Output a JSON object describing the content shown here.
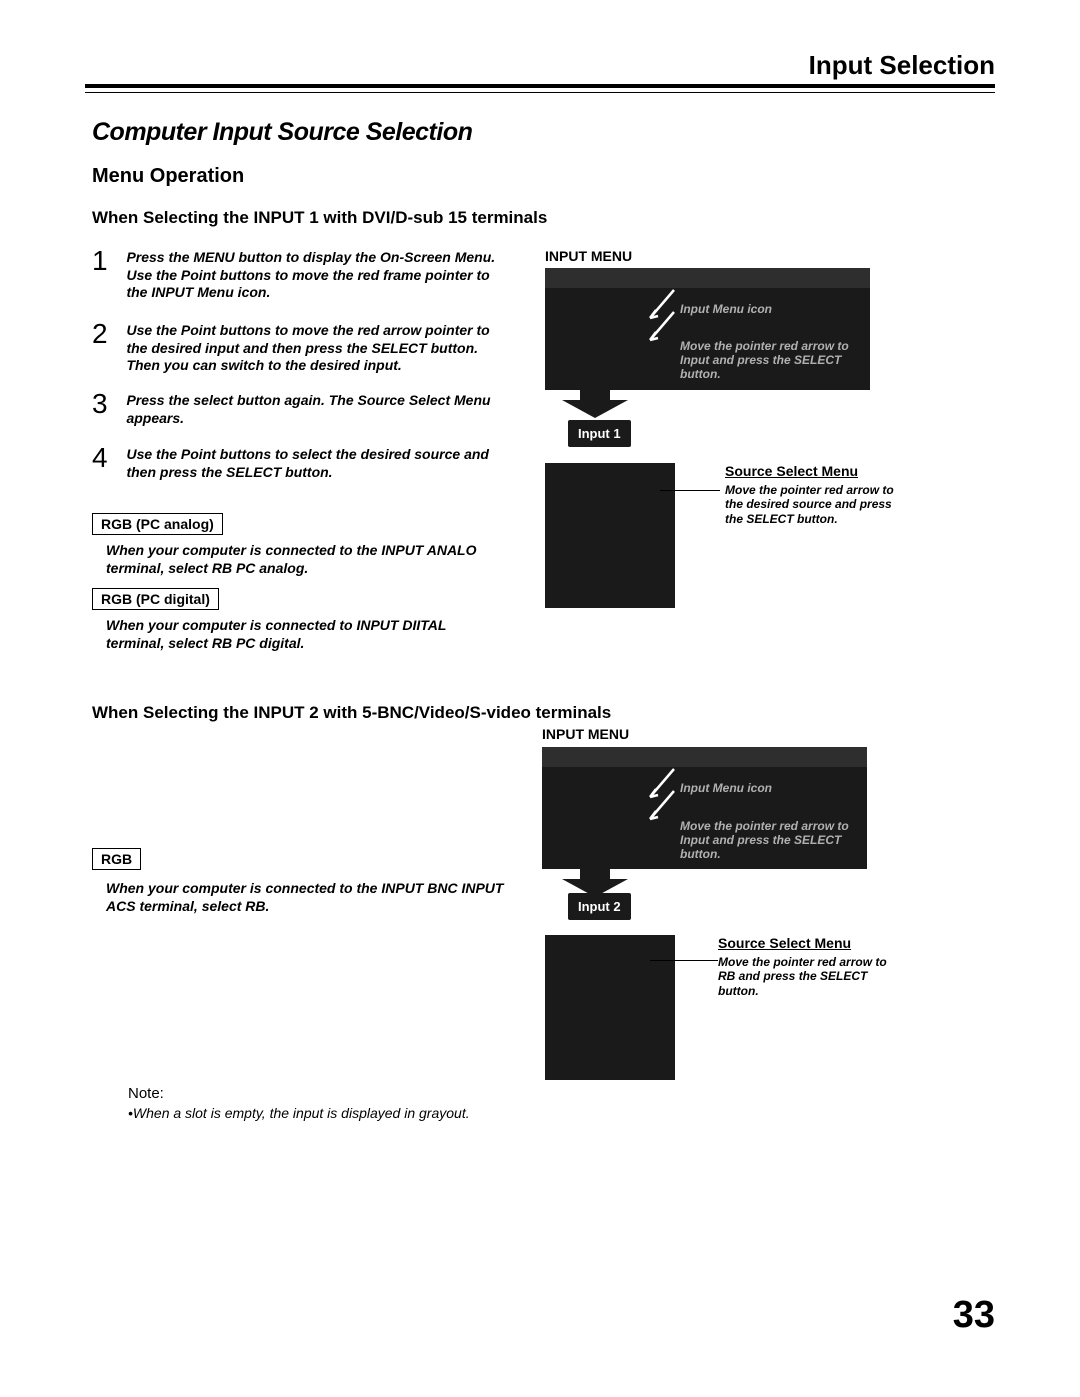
{
  "header": {
    "title": "Input Selection"
  },
  "section": {
    "title": "Computer Input Source Selection"
  },
  "menu_op": {
    "title": "Menu Operation"
  },
  "sub1": {
    "title": "When Selecting the INPUT 1 with DVI/D-sub 15 terminals"
  },
  "steps": {
    "s1": "Press the MENU button to display the On-Screen Menu. Use the Point       buttons to move the red frame pointer to the INPUT Menu icon.",
    "s2": "Use the Point       buttons to move the red arrow pointer to the desired input and then press the SELECT button. Then you can switch to the desired input.",
    "s3": "Press the select button again. The Source Select Menu appears.",
    "s4": "Use the Point       buttons to select the desired source and then press the SELECT button."
  },
  "rgb_pc_analog": {
    "label": "RGB (PC analog)",
    "desc": "When your computer is connected to the INPUT  ANALO terminal, select RB PC analog."
  },
  "rgb_pc_digital": {
    "label": "RGB (PC digital)",
    "desc": "When your computer is connected to INPUT  DIITAL terminal, select RB PC digital."
  },
  "sub2": {
    "title": "When Selecting the INPUT 2 with 5-BNC/Video/S-video terminals"
  },
  "rgb2": {
    "label": "RGB",
    "desc": "When your computer is connected to the INPUT   BNC INPUT ACS terminal, select RB."
  },
  "diagram1": {
    "input_menu_label": "INPUT MENU",
    "callout_icon": "Input Menu icon",
    "callout_pointer": "Move the pointer red arrow to Input and press the SELECT button.",
    "input_badge": "Input 1",
    "source_label": "Source Select Menu",
    "source_desc": "Move the pointer red arrow to the desired source and press the SELECT button."
  },
  "diagram2": {
    "input_menu_label": "INPUT MENU",
    "callout_icon": "Input Menu icon",
    "callout_pointer": "Move the pointer red arrow to Input and press the SELECT button.",
    "input_badge": "Input 2",
    "source_label": "Source Select Menu",
    "source_desc": "Move the pointer red arrow to RB and press the SELECT button."
  },
  "note": {
    "label": "Note:",
    "text": "•When a slot is empty, the input is displayed in grayout."
  },
  "page_number": "33"
}
